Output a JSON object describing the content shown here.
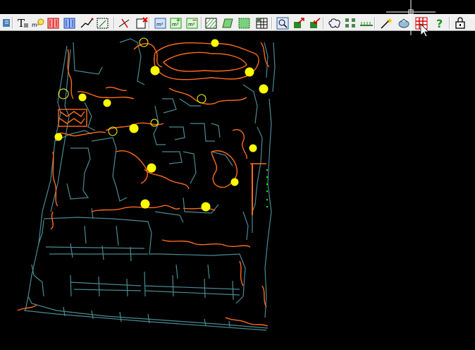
{
  "app": {
    "close_label": "×"
  },
  "toolbar": {
    "buttons": [
      {
        "name": "toolbar-grip-icon"
      },
      {
        "name": "text-style-icon"
      },
      {
        "name": "text-annotation-icon"
      },
      {
        "name": "mirror-red-icon"
      },
      {
        "name": "mirror-blue-icon"
      },
      {
        "name": "polyline-icon"
      },
      {
        "name": "dimension-box-icon"
      },
      {
        "name": "trim-icon"
      },
      {
        "name": "delete-object-icon"
      },
      {
        "name": "area-m2-icon"
      },
      {
        "name": "area-add-icon"
      },
      {
        "name": "area-subtract-icon"
      },
      {
        "name": "hatch-pattern-icon"
      },
      {
        "name": "hatch-green-icon"
      },
      {
        "name": "hatch-edit-icon"
      },
      {
        "name": "grid-table-icon"
      },
      {
        "name": "zoom-search-icon"
      },
      {
        "name": "export-arrow-icon"
      },
      {
        "name": "import-arrow-icon"
      },
      {
        "name": "cloud-shape-icon"
      },
      {
        "name": "array-blocks-icon"
      },
      {
        "name": "fence-line-icon"
      },
      {
        "name": "wand-icon"
      },
      {
        "name": "planting-icon"
      },
      {
        "name": "grid-red-icon"
      },
      {
        "name": "help-icon"
      },
      {
        "name": "lock-icon"
      }
    ],
    "help_glyph": "?"
  },
  "colors": {
    "wall": "#4a8a95",
    "planting": "#ff6a1a",
    "tree": "#ffff00",
    "accent_green": "#00ff00"
  }
}
